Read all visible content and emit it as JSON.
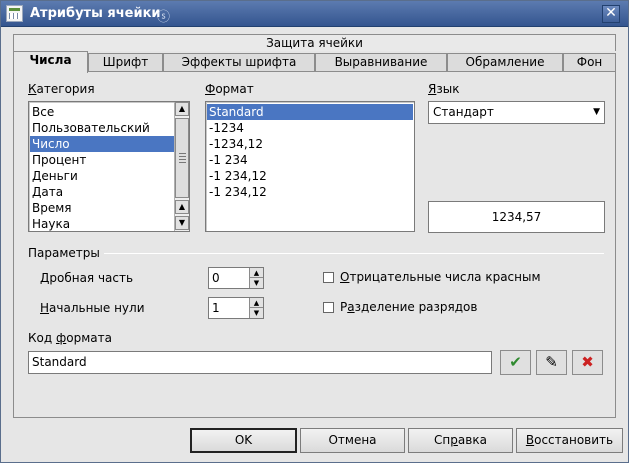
{
  "window": {
    "title": "Атрибуты ячейки",
    "title_glyph": "ⓢ",
    "close_glyph": "✕"
  },
  "tabs": {
    "top_row": "Защита ячейки",
    "row": [
      "Числа",
      "Шрифт",
      "Эффекты шрифта",
      "Выравнивание",
      "Обрамление",
      "Фон"
    ],
    "active_index": 0
  },
  "category": {
    "label_ul": "К",
    "label_rest": "атегория",
    "items": [
      "Все",
      "Пользовательский",
      "Число",
      "Процент",
      "Деньги",
      "Дата",
      "Время",
      "Наука"
    ],
    "selected": "Число"
  },
  "format": {
    "label_ul": "Ф",
    "label_rest": "ормат",
    "items": [
      "Standard",
      "-1234",
      "-1234,12",
      "-1 234",
      "-1 234,12",
      "-1 234,12"
    ],
    "selected": "Standard"
  },
  "language": {
    "label_ul": "Я",
    "label_rest": "зык",
    "value": "Стандарт",
    "arrow": "▼"
  },
  "preview": {
    "value": "1234,57"
  },
  "options": {
    "title": "Параметры",
    "decimal_ul": "Д",
    "decimal_rest": "робная часть",
    "decimal_value": "0",
    "leading_ul": "Н",
    "leading_rest": "ачальные нули",
    "leading_value": "1",
    "negative_ul": "О",
    "negative_rest": "трицательные числа красным",
    "thousands_pre": "Р",
    "thousands_ul": "а",
    "thousands_rest": "зделение разрядов",
    "spin_up": "▲",
    "spin_down": "▼"
  },
  "format_code": {
    "label_pre": "Код ",
    "label_ul": "ф",
    "label_rest": "ормата",
    "value": "Standard"
  },
  "code_buttons": {
    "add_glyph": "✔",
    "comment_glyph": "✎",
    "delete_glyph": "✖",
    "add_color": "#2f8a2f",
    "delete_color": "#cc2222"
  },
  "buttons": {
    "ok": "OK",
    "cancel": "Отмена",
    "help_pre": "Сп",
    "help_ul": "р",
    "help_rest": "авка",
    "reset_ul": "В",
    "reset_rest": "осстановить"
  }
}
